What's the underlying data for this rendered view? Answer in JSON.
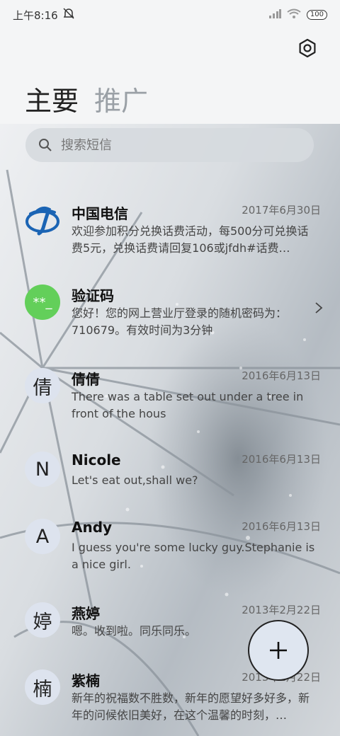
{
  "status": {
    "time": "上午8:16",
    "battery": "100"
  },
  "tabs": {
    "main": "主要",
    "promo": "推广"
  },
  "search": {
    "placeholder": "搜索短信"
  },
  "messages": [
    {
      "avatar": "",
      "avatar_icon": "china-telecom-logo",
      "name": "中国电信",
      "date": "2017年6月30日",
      "preview": "欢迎参加积分兑换话费活动，每500分可兑换话费5元，兑换话费请回复106或jfdh#话费…"
    },
    {
      "avatar": "**_",
      "avatar_color": "#63cf5a",
      "name": "验证码",
      "date": "",
      "preview": "您好！您的网上营业厅登录的随机密码为：710679。有效时间为3分钟"
    },
    {
      "avatar": "倩",
      "name": "倩倩",
      "date": "2016年6月13日",
      "preview": "There was a table set out under a tree in front of the hous"
    },
    {
      "avatar": "N",
      "name": "Nicole",
      "date": "2016年6月13日",
      "preview": "Let's eat out,shall we?"
    },
    {
      "avatar": "A",
      "name": "Andy",
      "date": "2016年6月13日",
      "preview": "I guess you're some lucky guy.Stephanie is a nice girl."
    },
    {
      "avatar": "婷",
      "name": "燕婷",
      "date": "2013年2月22日",
      "preview": "嗯。收到啦。同乐同乐。"
    },
    {
      "avatar": "楠",
      "name": "紫楠",
      "date": "2013年2月22日",
      "preview": "新年的祝福数不胜数，新年的愿望好多好多，新年的问候依旧美好，在这个温馨的时刻，…"
    }
  ],
  "colors": {
    "telecom_blue": "#1b64b4",
    "verify_green": "#63cf5a",
    "avatar_bg": "#dde3ee"
  }
}
